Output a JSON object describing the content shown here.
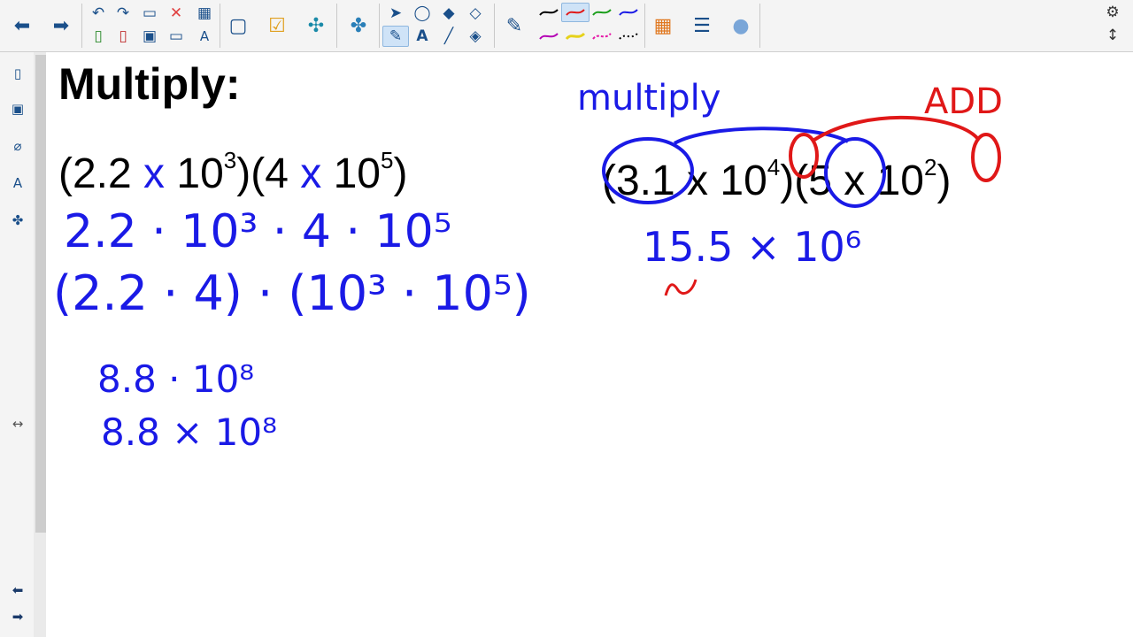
{
  "toolbar": {
    "icons": [
      "arrow-left-icon",
      "arrow-right-icon",
      "undo-icon",
      "redo-icon",
      "open-file-icon",
      "delete-icon",
      "table-icon",
      "new-page-icon",
      "delete-page-icon",
      "save-icon",
      "screen-shade-icon",
      "text-tool-icon",
      "document-camera-icon",
      "response-icon",
      "addon-icon",
      "puzzle-icon",
      "select-icon",
      "shapes-icon",
      "fill-icon",
      "eraser-icon",
      "pen-icon",
      "text-icon",
      "line-icon",
      "magic-pen-icon",
      "color-palette-icon",
      "line-style-icon",
      "fill-effects-icon",
      "settings-icon",
      "move-toolbar-icon"
    ],
    "pen_colors": [
      "#000000",
      "#e01818",
      "#1a9e1a",
      "#1a1ae6",
      "#b400b4",
      "#e6d21a",
      "#e61aa8",
      "#000000"
    ]
  },
  "sidebar": {
    "icons": [
      "page-sorter-icon",
      "gallery-icon",
      "attachments-icon",
      "properties-icon",
      "addons-icon",
      "resize-icon",
      "prev-page-icon",
      "next-page-icon"
    ]
  },
  "page": {
    "title": "Multiply:",
    "problem1": {
      "open": "(2.2 ",
      "x": "x",
      " base": "10",
      "exp": "3",
      "mid": ")(4 ",
      "x2": "x",
      "base2": "10",
      "exp2": "5",
      "close": ")"
    },
    "problem2": {
      "open": "(3.1 x 10",
      "exp": "4",
      "mid": ")(5 x 10",
      "exp2": "2",
      "close": ")"
    },
    "handwriting": {
      "line1": "2.2 · 10³ · 4 · 10⁵",
      "line2": "(2.2 · 4) · (10³ · 10⁵)",
      "line3": "8.8 · 10⁸",
      "line4": "8.8 × 10⁸",
      "multiply_label": "multiply",
      "add_label": "ADD",
      "answer2": "15.5 × 10⁶"
    }
  }
}
